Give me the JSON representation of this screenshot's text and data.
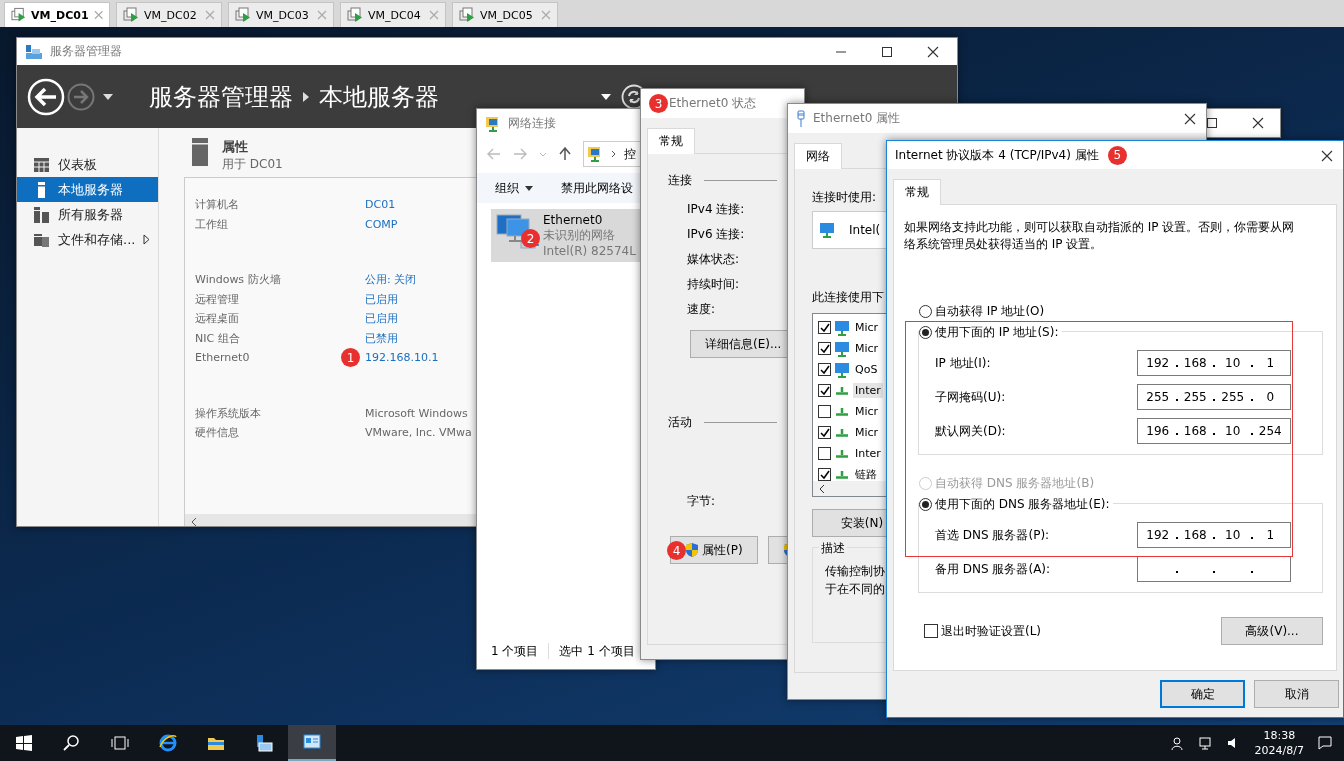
{
  "vm_tabs": [
    {
      "label": "VM_DC01",
      "selected": true
    },
    {
      "label": "VM_DC02",
      "selected": false
    },
    {
      "label": "VM_DC03",
      "selected": false
    },
    {
      "label": "VM_DC04",
      "selected": false
    },
    {
      "label": "VM_DC05",
      "selected": false
    }
  ],
  "server_manager": {
    "title": "服务器管理器",
    "breadcrumb": [
      "服务器管理器",
      "本地服务器"
    ],
    "nav": [
      {
        "label": "仪表板",
        "kind": "dashboard",
        "selected": false,
        "submenu": false
      },
      {
        "label": "本地服务器",
        "kind": "server",
        "selected": true,
        "submenu": false
      },
      {
        "label": "所有服务器",
        "kind": "servers",
        "selected": false,
        "submenu": false
      },
      {
        "label": "文件和存储...",
        "kind": "storage",
        "selected": false,
        "submenu": true
      }
    ],
    "section": {
      "title": "属性",
      "subtitle": "用于 DC01"
    },
    "property_groups": [
      [
        {
          "label": "计算机名",
          "value": "DC01",
          "link": true
        },
        {
          "label": "工作组",
          "value": "COMP",
          "link": true
        }
      ],
      [
        {
          "label": "Windows 防火墙",
          "value": "公用: 关闭",
          "link": true
        },
        {
          "label": "远程管理",
          "value": "已启用",
          "link": true
        },
        {
          "label": "远程桌面",
          "value": "已启用",
          "link": true
        },
        {
          "label": "NIC 组合",
          "value": "已禁用",
          "link": true
        },
        {
          "label": "Ethernet0",
          "value": "192.168.10.1",
          "link": true,
          "marker": "1"
        }
      ],
      [
        {
          "label": "操作系统版本",
          "value": "Microsoft Windows",
          "link": false
        },
        {
          "label": "硬件信息",
          "value": "VMware, Inc. VMwa",
          "link": false
        }
      ]
    ]
  },
  "network_connections": {
    "title": "网络连接",
    "address": "控",
    "toolbar": [
      {
        "label": "组织",
        "dropdown": true
      },
      {
        "label": "禁用此网络设",
        "dropdown": false
      }
    ],
    "items": [
      {
        "name": "Ethernet0",
        "status": "未识别的网络",
        "device": "Intel(R) 82574L",
        "selected": true,
        "marker": "2"
      }
    ],
    "status_bar": [
      "1 个项目",
      "选中 1 个项目"
    ]
  },
  "status_dialog": {
    "title": "Ethernet0 状态",
    "marker": "3",
    "tabs": [
      {
        "label": "常规",
        "selected": true
      }
    ],
    "connection_heading": "连接",
    "connection_fields": [
      "IPv4 连接:",
      "IPv6 连接:",
      "媒体状态:",
      "持续时间:",
      "速度:"
    ],
    "details_button": "详细信息(E)...",
    "activity_heading": "活动",
    "bytes_label": "字节:",
    "buttons": [
      {
        "label": "属性(P)",
        "shield": true,
        "marker": "4"
      },
      {
        "shield": true
      }
    ]
  },
  "properties_dialog": {
    "title": "Ethernet0 属性",
    "tabs": [
      {
        "label": "网络",
        "selected": true
      }
    ],
    "connect_using_label": "连接时使用:",
    "adapter": "Intel(",
    "items_label": "此连接使用下",
    "items": [
      {
        "label": "Micr",
        "checked": true,
        "kind": "client",
        "selected": false
      },
      {
        "label": "Micr",
        "checked": true,
        "kind": "client",
        "selected": false
      },
      {
        "label": "QoS",
        "checked": true,
        "kind": "client",
        "selected": false
      },
      {
        "label": "Inter",
        "checked": true,
        "kind": "protocol",
        "selected": true
      },
      {
        "label": "Micr",
        "checked": false,
        "kind": "protocol",
        "selected": false
      },
      {
        "label": "Micr",
        "checked": true,
        "kind": "protocol",
        "selected": false
      },
      {
        "label": "Inter",
        "checked": false,
        "kind": "protocol",
        "selected": false
      },
      {
        "label": "链路",
        "checked": true,
        "kind": "protocol",
        "selected": false
      }
    ],
    "install_button": "安装(N)",
    "description_heading": "描述",
    "description": [
      "传输控制协",
      "于在不同的"
    ]
  },
  "ipv4_dialog": {
    "title": "Internet 协议版本 4 (TCP/IPv4) 属性",
    "marker": "5",
    "tabs": [
      {
        "label": "常规",
        "selected": true
      }
    ],
    "intro": "如果网络支持此功能，则可以获取自动指派的 IP 设置。否则，你需要从网络系统管理员处获得适当的 IP 设置。",
    "ip_modes": [
      {
        "label": "自动获得 IP 地址(O)",
        "selected": false,
        "disabled": false
      },
      {
        "label": "使用下面的 IP 地址(S):",
        "selected": true,
        "disabled": false
      }
    ],
    "ip_fields": [
      {
        "label": "IP 地址(I):",
        "octets": [
          "192",
          "168",
          "10",
          "1"
        ]
      },
      {
        "label": "子网掩码(U):",
        "octets": [
          "255",
          "255",
          "255",
          "0"
        ]
      },
      {
        "label": "默认网关(D):",
        "octets": [
          "196",
          "168",
          "10",
          "254"
        ]
      }
    ],
    "dns_modes": [
      {
        "label": "自动获得 DNS 服务器地址(B)",
        "selected": false,
        "disabled": true
      },
      {
        "label": "使用下面的 DNS 服务器地址(E):",
        "selected": true,
        "disabled": false
      }
    ],
    "dns_fields": [
      {
        "label": "首选 DNS 服务器(P):",
        "octets": [
          "192",
          "168",
          "10",
          "1"
        ]
      },
      {
        "label": "备用 DNS 服务器(A):"
      }
    ],
    "validate": {
      "label": "退出时验证设置(L)",
      "checked": false
    },
    "advanced_button": "高级(V)...",
    "buttons": [
      {
        "label": "确定",
        "default": true
      },
      {
        "label": "取消",
        "default": false
      }
    ],
    "highlight_frame": true
  },
  "taskbar": {
    "items": [
      {
        "kind": "start",
        "active": false
      },
      {
        "kind": "search",
        "active": false
      },
      {
        "kind": "task_view",
        "active": false
      },
      {
        "kind": "browser",
        "active": false
      },
      {
        "kind": "folder",
        "active": false
      },
      {
        "kind": "server_manager",
        "active": false
      },
      {
        "kind": "network",
        "active": true
      }
    ],
    "tray": [
      {
        "kind": "people"
      },
      {
        "kind": "network"
      },
      {
        "kind": "volume"
      }
    ],
    "clock": {
      "time": "18:38",
      "date": "2024/8/7"
    }
  }
}
